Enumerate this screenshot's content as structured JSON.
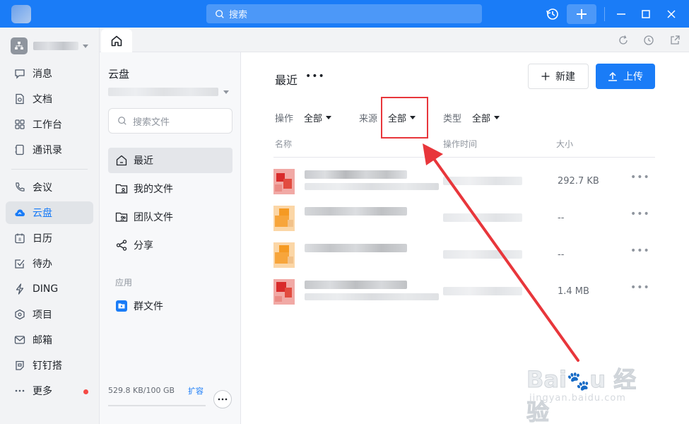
{
  "titlebar": {
    "search_placeholder": "搜索"
  },
  "nav": {
    "items": [
      {
        "label": "消息",
        "icon": "message-icon"
      },
      {
        "label": "文档",
        "icon": "doc-icon"
      },
      {
        "label": "工作台",
        "icon": "grid-icon"
      },
      {
        "label": "通讯录",
        "icon": "contacts-icon"
      },
      {
        "label": "会议",
        "icon": "phone-icon"
      },
      {
        "label": "云盘",
        "icon": "cloud-icon"
      },
      {
        "label": "日历",
        "icon": "calendar-icon"
      },
      {
        "label": "待办",
        "icon": "todo-icon"
      },
      {
        "label": "DING",
        "icon": "lightning-icon"
      },
      {
        "label": "项目",
        "icon": "project-icon"
      },
      {
        "label": "邮箱",
        "icon": "mail-icon"
      },
      {
        "label": "钉钉搭",
        "icon": "builder-icon"
      },
      {
        "label": "更多",
        "icon": "more-icon"
      }
    ],
    "active": "云盘"
  },
  "drive": {
    "title": "云盘",
    "search_placeholder": "搜索文件",
    "items": [
      {
        "label": "最近",
        "icon": "home-icon"
      },
      {
        "label": "我的文件",
        "icon": "my-files-icon"
      },
      {
        "label": "团队文件",
        "icon": "team-files-icon"
      },
      {
        "label": "分享",
        "icon": "share-icon"
      }
    ],
    "section_apps": "应用",
    "app_items": [
      {
        "label": "群文件",
        "icon": "group-files-icon"
      }
    ],
    "storage": "529.8 KB/100 GB",
    "expand": "扩容"
  },
  "main": {
    "title": "最近",
    "more": "•••",
    "new_label": "新建",
    "upload_label": "上传",
    "filters": [
      {
        "label": "操作",
        "value": "全部"
      },
      {
        "label": "来源",
        "value": "全部"
      },
      {
        "label": "类型",
        "value": "全部"
      }
    ],
    "columns": [
      "名称",
      "操作时间",
      "大小"
    ],
    "rows": [
      {
        "size": "292.7 KB",
        "type": "red"
      },
      {
        "size": "--",
        "type": "orange"
      },
      {
        "size": "--",
        "type": "orange"
      },
      {
        "size": "1.4 MB",
        "type": "red"
      }
    ]
  },
  "watermark": {
    "brand": "Bai",
    "brand_cn": "经验",
    "url": "jingyan.baidu.com"
  },
  "colors": {
    "accent": "#1a7cf7",
    "annotation": "#e8363b"
  }
}
